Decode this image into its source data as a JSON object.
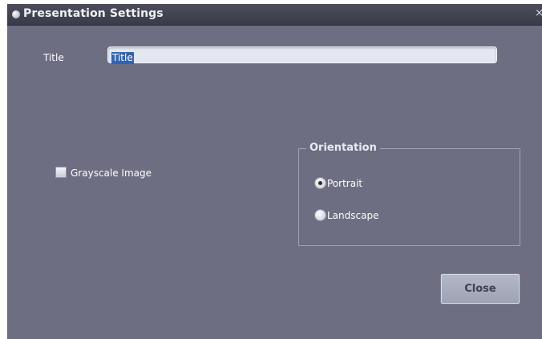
{
  "window": {
    "title": "Presentation Settings",
    "close_glyph": "×"
  },
  "form": {
    "title_label": "Title",
    "title_value": "Title",
    "grayscale_label": "Grayscale Image",
    "grayscale_checked": false
  },
  "orientation": {
    "group_label": "Orientation",
    "options": [
      {
        "label": "Portrait",
        "selected": true
      },
      {
        "label": "Landscape",
        "selected": false
      }
    ]
  },
  "buttons": {
    "close_label": "Close"
  },
  "colors": {
    "window_bg": "#6d6e82",
    "titlebar_bg": "#3f404e",
    "selection": "#2f64b5"
  }
}
